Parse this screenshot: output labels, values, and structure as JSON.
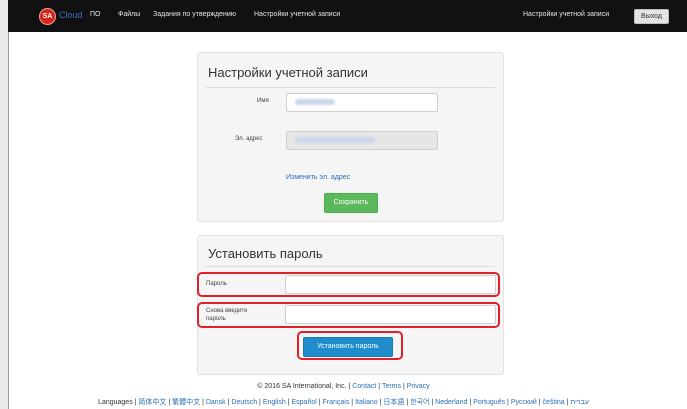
{
  "nav": {
    "logo_badge": "SA",
    "logo_word": "Cloud",
    "links": [
      "ПО",
      "Файлы",
      "Задания по утверждению",
      "Настройки учетной записи"
    ],
    "right_link": "Настройки учетной записи",
    "logout": "Выход"
  },
  "account": {
    "title": "Настройки учетной записи",
    "name_label": "Имя",
    "email_label": "Эл. адрес",
    "change_email": "Изменить эл. адрес",
    "save": "Сохранить"
  },
  "password": {
    "title": "Установить пароль",
    "password_label": "Пароль",
    "confirm_label_1": "Снова введите",
    "confirm_label_2": "пароль",
    "submit": "Установить пароль"
  },
  "footer": {
    "copyright": "© 2016 SA International, Inc. | ",
    "contact": "Contact",
    "terms": "Terms",
    "privacy": "Privacy",
    "sep": " | ",
    "languages_label": "Languages | ",
    "languages": [
      "简体中文",
      "繁體中文",
      "Dansk",
      "Deutsch",
      "English",
      "Español",
      "Français",
      "Italiano",
      "日本語",
      "한국어",
      "Nederland",
      "Português",
      "Русский",
      "čeština",
      "עברית"
    ]
  },
  "colors": {
    "navbar": "#111111",
    "accent_link": "#2a6fb8",
    "save_button": "#5cb85c",
    "set_password_button": "#1f8dcb",
    "highlight": "#e0202a"
  }
}
